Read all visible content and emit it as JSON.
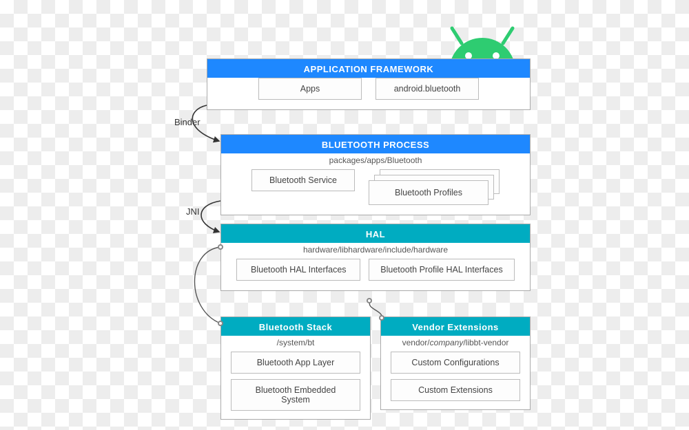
{
  "connectors": {
    "binder": "Binder",
    "jni": "JNI"
  },
  "app_framework": {
    "title": "APPLICATION FRAMEWORK",
    "cells": [
      "Apps",
      "android.bluetooth"
    ]
  },
  "bt_process": {
    "title": "BLUETOOTH PROCESS",
    "path": "packages/apps/Bluetooth",
    "service": "Bluetooth Service",
    "profiles": "Bluetooth Profiles"
  },
  "hal": {
    "title": "HAL",
    "path": "hardware/libhardware/include/hardware",
    "cells": [
      "Bluetooth HAL Interfaces",
      "Bluetooth Profile HAL Interfaces"
    ]
  },
  "bt_stack": {
    "title": "Bluetooth Stack",
    "path": "/system/bt",
    "cells": [
      "Bluetooth App Layer",
      "Bluetooth Embedded System"
    ]
  },
  "vendor": {
    "title": "Vendor Extensions",
    "path": "vendor/company/libbt-vendor",
    "cells": [
      "Custom Configurations",
      "Custom Extensions"
    ]
  }
}
